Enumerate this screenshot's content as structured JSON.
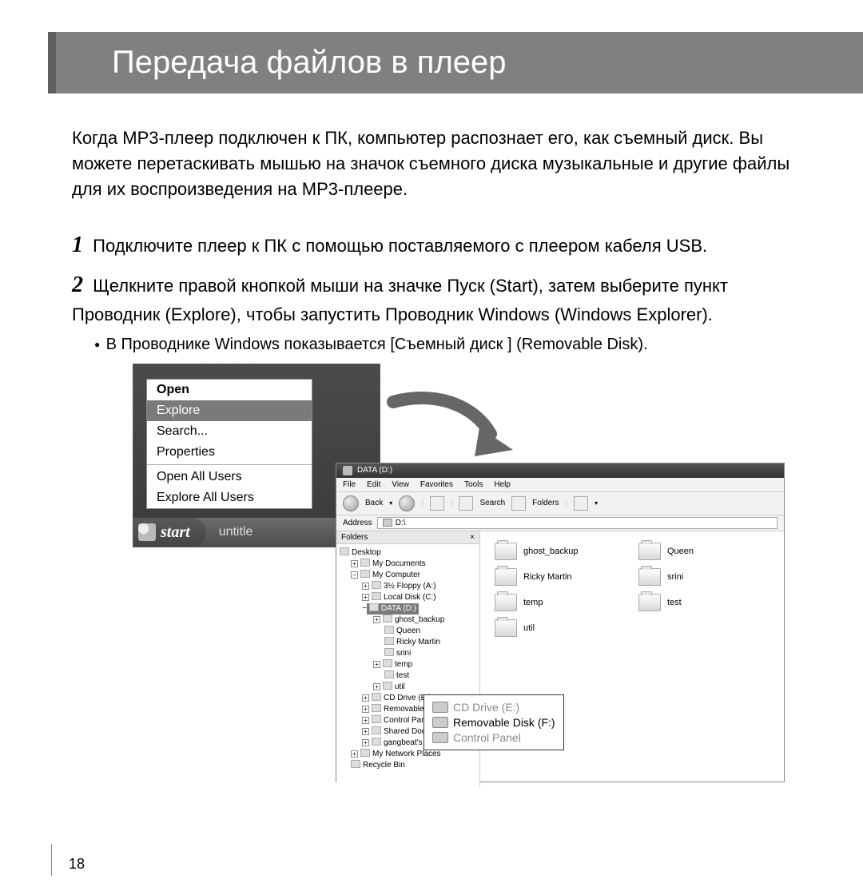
{
  "title": "Передача файлов в плеер",
  "intro": "Когда МР3-плеер подключен к ПК, компьютер распознает его, как съемный диск. Вы можете перетаскивать мышью на значок съемного диска музыкальные и другие файлы для их воспроизведения на МР3-плеере.",
  "steps": {
    "s1": {
      "num": "1",
      "text": "Подключите плеер к ПК с помощью поставляемого с плеером кабеля USB."
    },
    "s2": {
      "num": "2",
      "text": "Щелкните правой кнопкой мыши на значке Пуск (Start), затем выберите пункт Проводник (Explore), чтобы запустить Проводник Windows (Windows Explorer)."
    }
  },
  "bullet": "В Проводнике Windows показывается [Съемный диск ] (Removable Disk).",
  "context_menu": {
    "open": "Open",
    "explore": "Explore",
    "search": "Search...",
    "properties": "Properties",
    "open_all": "Open All Users",
    "explore_all": "Explore All Users"
  },
  "taskbar": {
    "start": "start",
    "untitled": "untitle"
  },
  "explorer": {
    "title": "DATA (D:)",
    "menu": {
      "file": "File",
      "edit": "Edit",
      "view": "View",
      "fav": "Favorites",
      "tools": "Tools",
      "help": "Help"
    },
    "toolbar": {
      "back": "Back",
      "search": "Search",
      "folders": "Folders"
    },
    "address_label": "Address",
    "address_value": "D:\\",
    "tree_header": "Folders",
    "tree": {
      "desktop": "Desktop",
      "mydocs": "My Documents",
      "mycomp": "My Computer",
      "floppy": "3½ Floppy (A:)",
      "localc": "Local Disk (C:)",
      "datad": "DATA (D:)",
      "ghost": "ghost_backup",
      "queen": "Queen",
      "ricky": "Ricky Martin",
      "srini": "srini",
      "temp": "temp",
      "test": "test",
      "util": "util",
      "cde": "CD Drive (E:)",
      "remf": "Removable Disk (F:)",
      "cpl": "Control Panel",
      "shared": "Shared Documents",
      "gang": "gangbeat's Documents",
      "netplaces": "My Network Places",
      "recycle": "Recycle Bin"
    },
    "files": {
      "f1": "ghost_backup",
      "f2": "Queen",
      "f3": "Ricky Martin",
      "f4": "srini",
      "f5": "temp",
      "f6": "test",
      "f7": "util"
    }
  },
  "callout": {
    "line1": "CD Drive (E:)",
    "line2": "Removable Disk (F:)",
    "line3": "Control Panel"
  },
  "page_number": "18"
}
